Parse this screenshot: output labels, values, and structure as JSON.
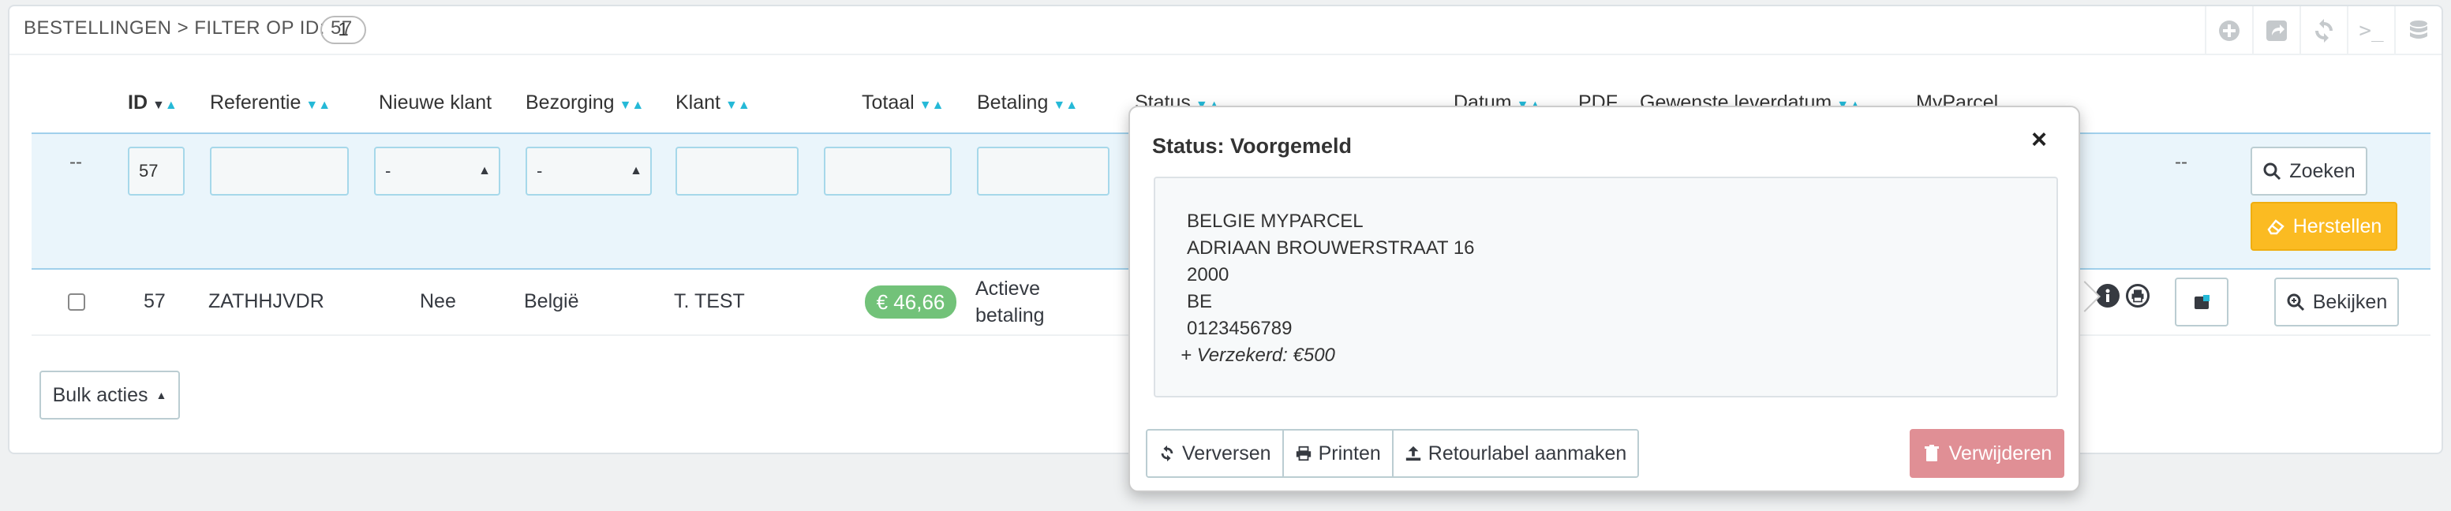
{
  "header": {
    "title": "BESTELLINGEN > FILTER OP ID: 57",
    "count": "1"
  },
  "toolbar": {
    "icons": [
      "add-icon",
      "export-icon",
      "refresh-icon",
      "terminal-icon",
      "database-icon"
    ],
    "terminal_label": ">_"
  },
  "columns": {
    "id": "ID",
    "referentie": "Referentie",
    "nieuwe_klant": "Nieuwe klant",
    "bezorging": "Bezorging",
    "klant": "Klant",
    "totaal": "Totaal",
    "betaling": "Betaling",
    "status": "Status",
    "datum": "Datum",
    "pdf": "PDF",
    "gewenste_leverdatum": "Gewenste leverdatum",
    "myparcel": "MyParcel"
  },
  "filters": {
    "dash": "--",
    "id_value": "57",
    "nieuwe_klant_selected": "-",
    "bezorging_selected": "-",
    "dash_right": "--",
    "zoeken_label": "Zoeken",
    "herstellen_label": "Herstellen"
  },
  "row": {
    "id": "57",
    "referentie": "ZATHHJVDR",
    "nieuwe_klant": "Nee",
    "bezorging": "België",
    "klant": "T. TEST",
    "totaal": "€ 46,66",
    "betaling_line1": "Actieve",
    "betaling_line2": "betaling",
    "bekijken_label": "Bekijken"
  },
  "bulk": {
    "label": "Bulk acties"
  },
  "popover": {
    "title": "Status: Voorgemeld",
    "close": "×",
    "address": {
      "name": "BELGIE MYPARCEL",
      "street": "ADRIAAN BROUWERSTRAAT 16",
      "postcode": "2000",
      "country": "BE",
      "phone": "0123456789",
      "insured": "+ Verzekerd: €500"
    },
    "buttons": {
      "verversen": "Verversen",
      "printen": "Printen",
      "retourlabel": "Retourlabel aanmaken",
      "verwijderen": "Verwijderen"
    }
  },
  "colors": {
    "accent": "#25b9d7",
    "success": "#72c279",
    "warning": "#fbbb22",
    "danger": "#e08f95",
    "filter_bg": "#eaf5fb"
  }
}
